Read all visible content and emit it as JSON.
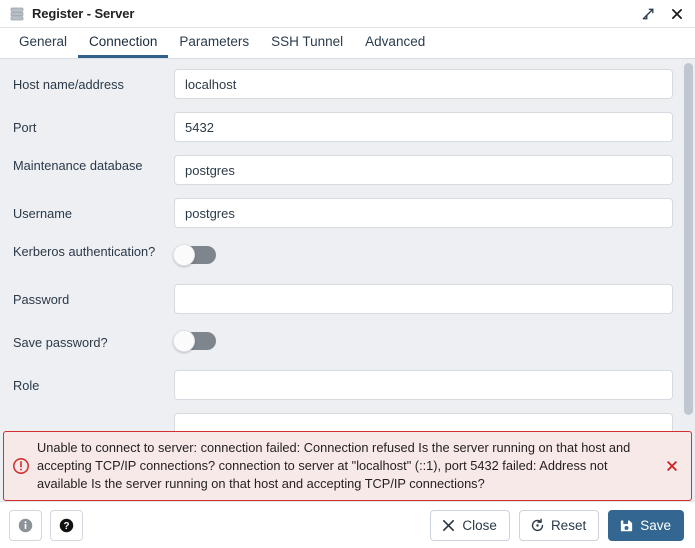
{
  "titlebar": {
    "icon": "server-icon",
    "title": "Register - Server",
    "expand_icon": "expand-diagonal-icon",
    "close_icon": "close-icon"
  },
  "tabs": [
    {
      "label": "General",
      "active": false
    },
    {
      "label": "Connection",
      "active": true
    },
    {
      "label": "Parameters",
      "active": false
    },
    {
      "label": "SSH Tunnel",
      "active": false
    },
    {
      "label": "Advanced",
      "active": false
    }
  ],
  "form": {
    "fields": [
      {
        "label": "Host name/address",
        "type": "text",
        "value": "localhost",
        "placeholder": "",
        "name": "host-name-address"
      },
      {
        "label": "Port",
        "type": "text",
        "value": "5432",
        "placeholder": "",
        "name": "port"
      },
      {
        "label": "Maintenance database",
        "type": "text",
        "value": "postgres",
        "placeholder": "",
        "name": "maintenance-database"
      },
      {
        "label": "Username",
        "type": "text",
        "value": "postgres",
        "placeholder": "",
        "name": "username"
      },
      {
        "label": "Kerberos authentication?",
        "type": "toggle",
        "value": "off",
        "name": "kerberos-authentication"
      },
      {
        "label": "Password",
        "type": "password",
        "value": "",
        "placeholder": "",
        "name": "password"
      },
      {
        "label": "Save password?",
        "type": "toggle",
        "value": "off",
        "name": "save-password"
      },
      {
        "label": "Role",
        "type": "text",
        "value": "",
        "placeholder": "",
        "name": "role"
      },
      {
        "label": "",
        "type": "text",
        "value": "",
        "placeholder": "",
        "name": "service"
      }
    ]
  },
  "error": {
    "icon": "error-circle-icon",
    "message": "Unable to connect to server: connection failed: Connection refused Is the server running on that host and accepting TCP/IP connections? connection to server at \"localhost\" (::1), port 5432 failed: Address not available Is the server running on that host and accepting TCP/IP connections?",
    "close_icon": "close-icon",
    "border_color": "#d32f2f",
    "background_color": "#f8e9e9"
  },
  "footer": {
    "info_label": "",
    "help_label": "",
    "close_label": "Close",
    "reset_label": "Reset",
    "save_label": "Save",
    "save_color": "#336791"
  }
}
